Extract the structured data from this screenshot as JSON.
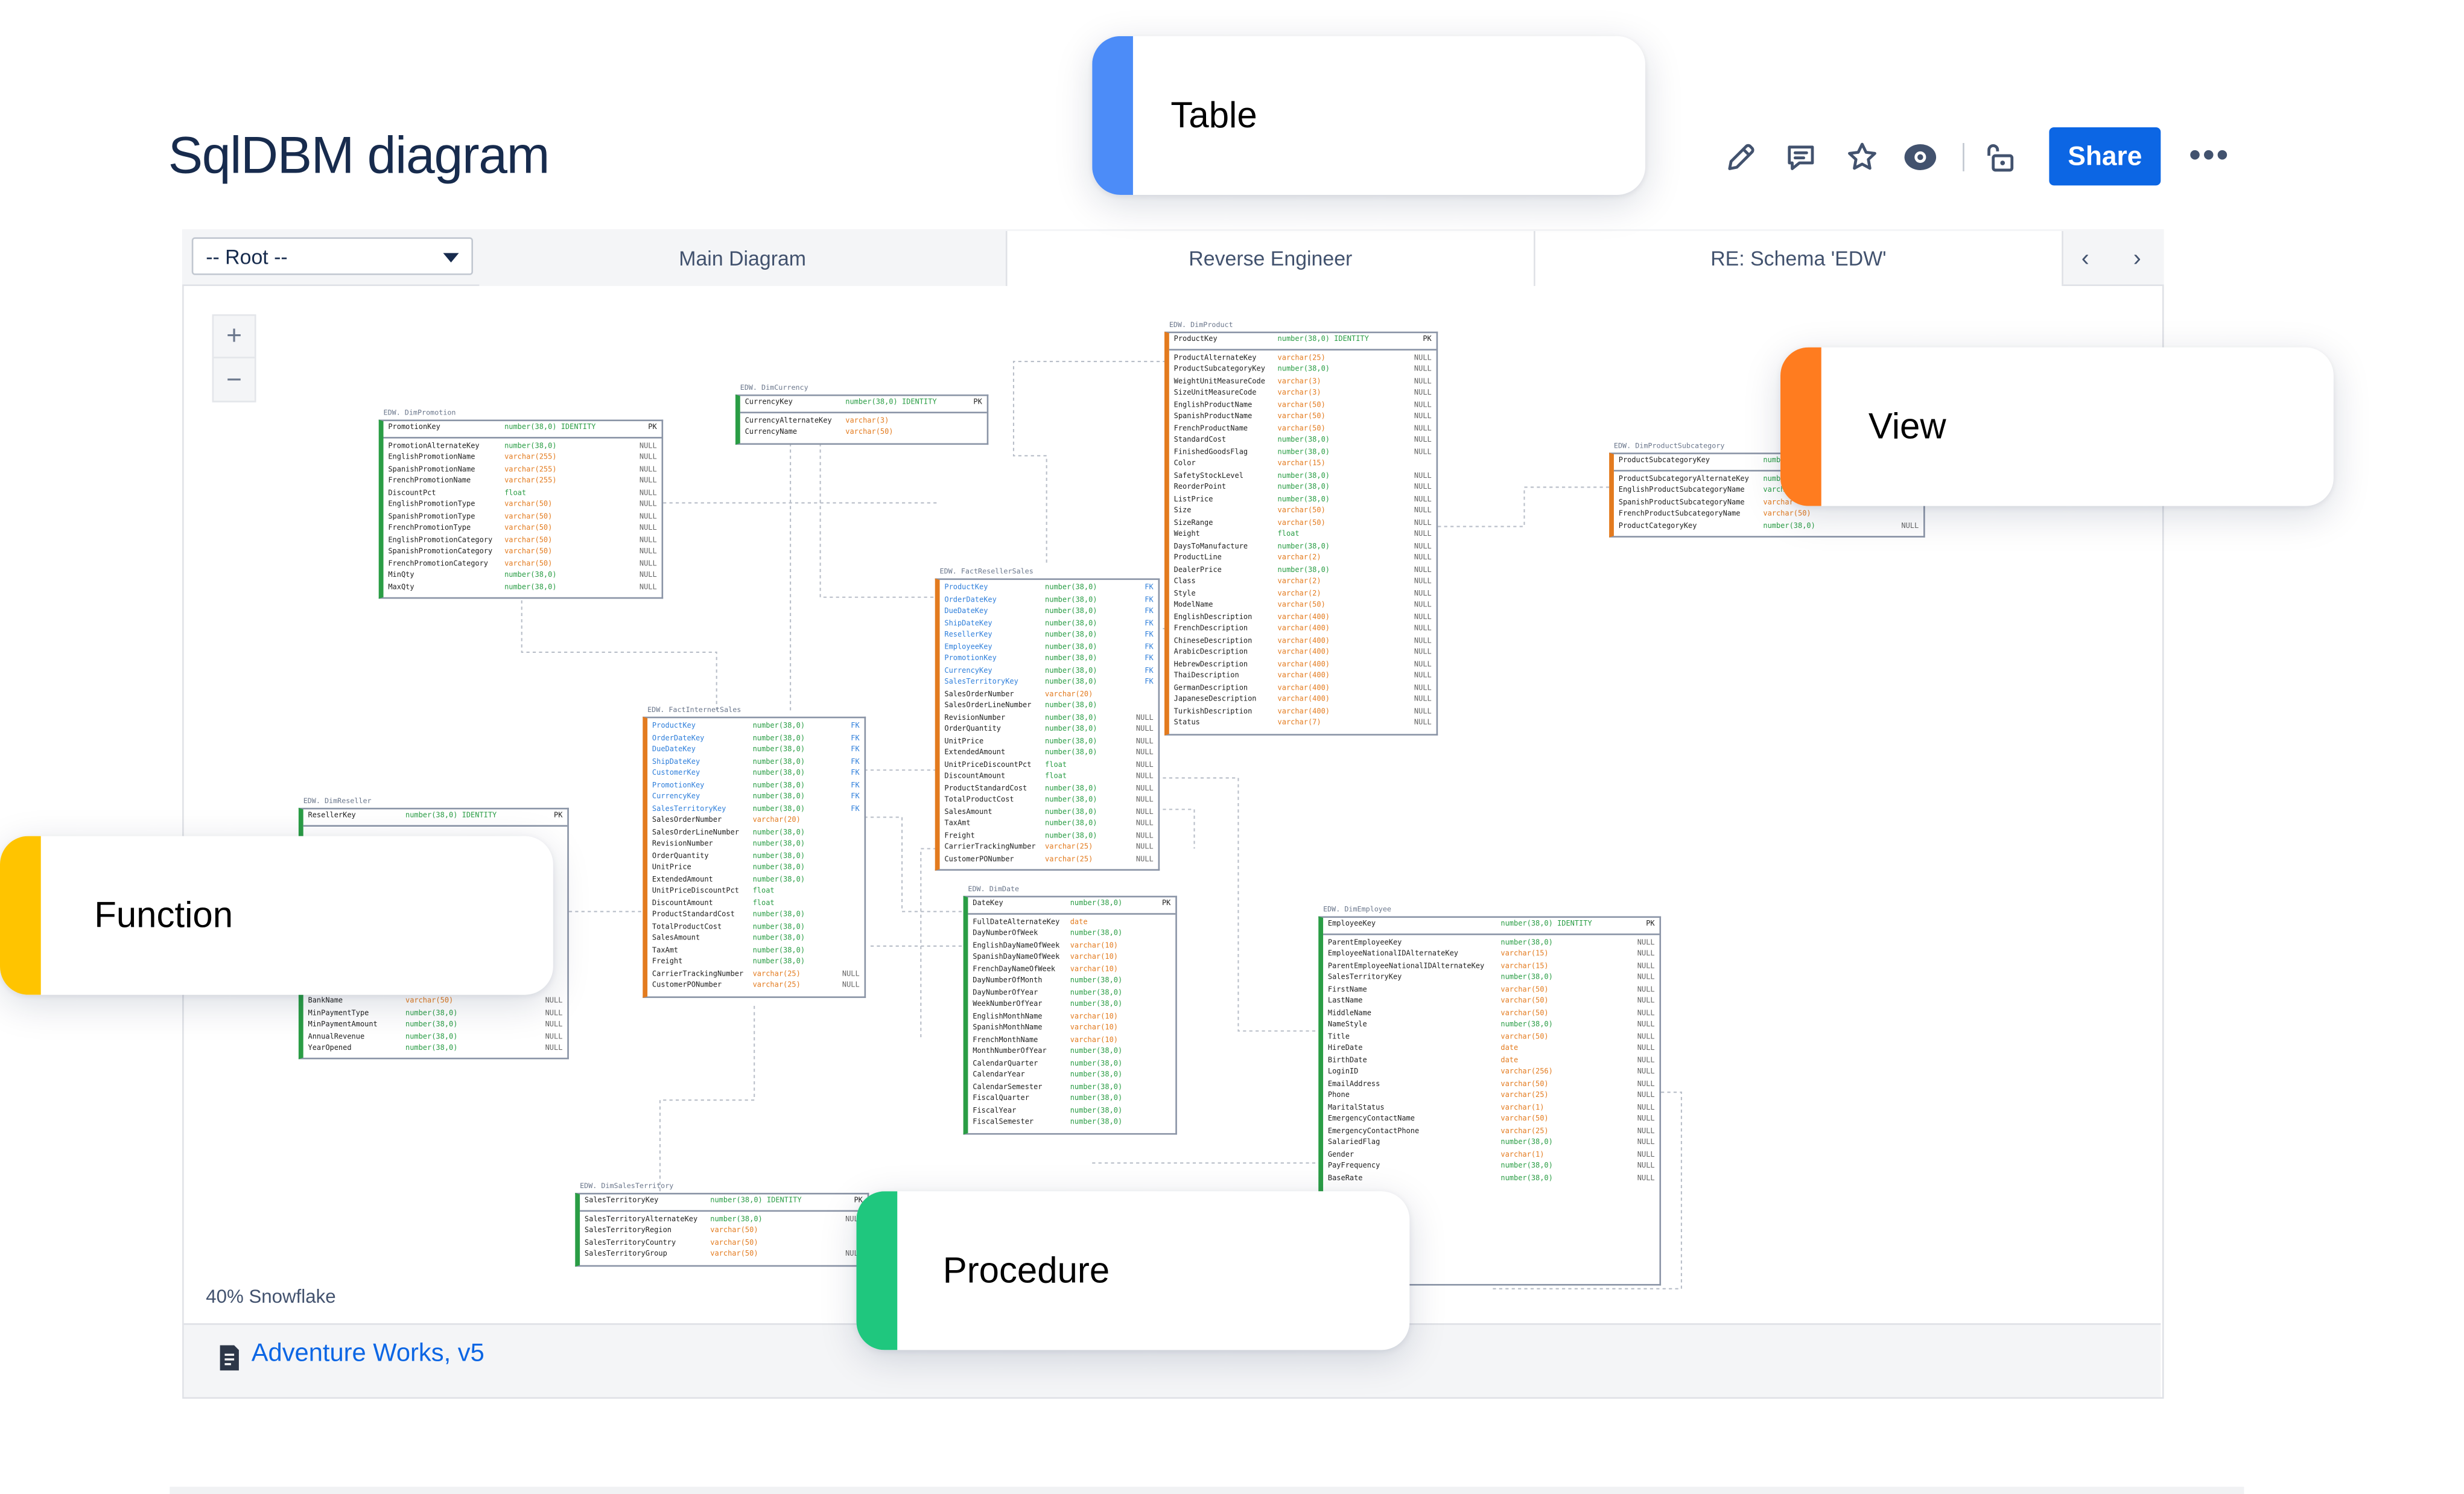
{
  "page": {
    "title": "SqlDBM diagram"
  },
  "toolbar": {
    "share_label": "Share",
    "more_label": "•••",
    "icons": [
      "pencil-icon",
      "comment-icon",
      "star-icon",
      "eye-icon",
      "unlock-icon"
    ]
  },
  "macro": {
    "root_select": "-- Root --",
    "tabs": [
      "Main Diagram",
      "Reverse Engineer",
      "RE: Schema 'EDW'"
    ],
    "prev": "‹",
    "next": "›",
    "zoom_in": "+",
    "zoom_out": "−",
    "zoom_label": "40% Snowflake",
    "footer_link": "Adventure Works, v5"
  },
  "callouts": {
    "table": "Table",
    "view": "View",
    "function": "Function",
    "procedure": "Procedure"
  },
  "colors": {
    "table": "#4c8cf8",
    "view": "#ff7c1f",
    "function": "#ffc400",
    "procedure": "#1fc77e",
    "share": "#0c66e4"
  },
  "diagram": {
    "dim_promotion": {
      "caption": "EDW. DimPromotion",
      "header": [
        "PromotionKey",
        "number(38,0) IDENTITY",
        "PK"
      ],
      "rows": [
        [
          "PromotionAlternateKey",
          "number(38,0)",
          "NULL"
        ],
        [
          "EnglishPromotionName",
          "varchar(255)",
          "NULL"
        ],
        [
          "SpanishPromotionName",
          "varchar(255)",
          "NULL"
        ],
        [
          "FrenchPromotionName",
          "varchar(255)",
          "NULL"
        ],
        [
          "DiscountPct",
          "float",
          "NULL"
        ],
        [
          "EnglishPromotionType",
          "varchar(50)",
          "NULL"
        ],
        [
          "SpanishPromotionType",
          "varchar(50)",
          "NULL"
        ],
        [
          "FrenchPromotionType",
          "varchar(50)",
          "NULL"
        ],
        [
          "EnglishPromotionCategory",
          "varchar(50)",
          "NULL"
        ],
        [
          "SpanishPromotionCategory",
          "varchar(50)",
          "NULL"
        ],
        [
          "FrenchPromotionCategory",
          "varchar(50)",
          "NULL"
        ],
        [
          "MinQty",
          "number(38,0)",
          "NULL"
        ],
        [
          "MaxQty",
          "number(38,0)",
          "NULL"
        ]
      ]
    },
    "dim_currency": {
      "caption": "EDW. DimCurrency",
      "header": [
        "CurrencyKey",
        "number(38,0) IDENTITY",
        "PK"
      ],
      "rows": [
        [
          "CurrencyAlternateKey",
          "varchar(3)",
          ""
        ],
        [
          "CurrencyName",
          "varchar(50)",
          ""
        ]
      ]
    },
    "dim_product": {
      "caption": "EDW. DimProduct",
      "header": [
        "ProductKey",
        "number(38,0) IDENTITY",
        "PK"
      ],
      "rows": [
        [
          "ProductAlternateKey",
          "varchar(25)",
          "NULL"
        ],
        [
          "ProductSubcategoryKey",
          "number(38,0)",
          "NULL"
        ],
        [
          "WeightUnitMeasureCode",
          "varchar(3)",
          "NULL"
        ],
        [
          "SizeUnitMeasureCode",
          "varchar(3)",
          "NULL"
        ],
        [
          "EnglishProductName",
          "varchar(50)",
          "NULL"
        ],
        [
          "SpanishProductName",
          "varchar(50)",
          "NULL"
        ],
        [
          "FrenchProductName",
          "varchar(50)",
          "NULL"
        ],
        [
          "StandardCost",
          "number(38,0)",
          "NULL"
        ],
        [
          "FinishedGoodsFlag",
          "number(38,0)",
          "NULL"
        ],
        [
          "Color",
          "varchar(15)",
          ""
        ],
        [
          "SafetyStockLevel",
          "number(38,0)",
          "NULL"
        ],
        [
          "ReorderPoint",
          "number(38,0)",
          "NULL"
        ],
        [
          "ListPrice",
          "number(38,0)",
          "NULL"
        ],
        [
          "Size",
          "varchar(50)",
          "NULL"
        ],
        [
          "SizeRange",
          "varchar(50)",
          "NULL"
        ],
        [
          "Weight",
          "float",
          "NULL"
        ],
        [
          "DaysToManufacture",
          "number(38,0)",
          "NULL"
        ],
        [
          "ProductLine",
          "varchar(2)",
          "NULL"
        ],
        [
          "DealerPrice",
          "number(38,0)",
          "NULL"
        ],
        [
          "Class",
          "varchar(2)",
          "NULL"
        ],
        [
          "Style",
          "varchar(2)",
          "NULL"
        ],
        [
          "ModelName",
          "varchar(50)",
          "NULL"
        ],
        [
          "EnglishDescription",
          "varchar(400)",
          "NULL"
        ],
        [
          "FrenchDescription",
          "varchar(400)",
          "NULL"
        ],
        [
          "ChineseDescription",
          "varchar(400)",
          "NULL"
        ],
        [
          "ArabicDescription",
          "varchar(400)",
          "NULL"
        ],
        [
          "HebrewDescription",
          "varchar(400)",
          "NULL"
        ],
        [
          "ThaiDescription",
          "varchar(400)",
          "NULL"
        ],
        [
          "GermanDescription",
          "varchar(400)",
          "NULL"
        ],
        [
          "JapaneseDescription",
          "varchar(400)",
          "NULL"
        ],
        [
          "TurkishDescription",
          "varchar(400)",
          "NULL"
        ],
        [
          "Status",
          "varchar(7)",
          "NULL"
        ]
      ]
    },
    "dim_product_subcategory": {
      "caption": "EDW. DimProductSubcategory",
      "header": [
        "ProductSubcategoryKey",
        "numb",
        ""
      ],
      "rows": [
        [
          "ProductSubcategoryAlternateKey",
          "numbe",
          ""
        ],
        [
          "EnglishProductSubcategoryName",
          "varcha",
          ""
        ],
        [
          "SpanishProductSubcategoryName",
          "varchar",
          ""
        ],
        [
          "FrenchProductSubcategoryName",
          "varchar(50)",
          ""
        ],
        [
          "ProductCategoryKey",
          "number(38,0)",
          "NULL"
        ]
      ]
    },
    "fact_reseller_sales": {
      "caption": "EDW. FactResellerSales",
      "rows": [
        [
          "ProductKey",
          "number(38,0)",
          "FK"
        ],
        [
          "OrderDateKey",
          "number(38,0)",
          "FK"
        ],
        [
          "DueDateKey",
          "number(38,0)",
          "FK"
        ],
        [
          "ShipDateKey",
          "number(38,0)",
          "FK"
        ],
        [
          "ResellerKey",
          "number(38,0)",
          "FK"
        ],
        [
          "EmployeeKey",
          "number(38,0)",
          "FK"
        ],
        [
          "PromotionKey",
          "number(38,0)",
          "FK"
        ],
        [
          "CurrencyKey",
          "number(38,0)",
          "FK"
        ],
        [
          "SalesTerritoryKey",
          "number(38,0)",
          "FK"
        ],
        [
          "SalesOrderNumber",
          "varchar(20)",
          ""
        ],
        [
          "SalesOrderLineNumber",
          "number(38,0)",
          ""
        ],
        [
          "RevisionNumber",
          "number(38,0)",
          "NULL"
        ],
        [
          "OrderQuantity",
          "number(38,0)",
          "NULL"
        ],
        [
          "UnitPrice",
          "number(38,0)",
          "NULL"
        ],
        [
          "ExtendedAmount",
          "number(38,0)",
          "NULL"
        ],
        [
          "UnitPriceDiscountPct",
          "float",
          "NULL"
        ],
        [
          "DiscountAmount",
          "float",
          "NULL"
        ],
        [
          "ProductStandardCost",
          "number(38,0)",
          "NULL"
        ],
        [
          "TotalProductCost",
          "number(38,0)",
          "NULL"
        ],
        [
          "SalesAmount",
          "number(38,0)",
          "NULL"
        ],
        [
          "TaxAmt",
          "number(38,0)",
          "NULL"
        ],
        [
          "Freight",
          "number(38,0)",
          "NULL"
        ],
        [
          "CarrierTrackingNumber",
          "varchar(25)",
          "NULL"
        ],
        [
          "CustomerPONumber",
          "varchar(25)",
          "NULL"
        ]
      ]
    },
    "fact_internet_sales": {
      "caption": "EDW. FactInternetSales",
      "rows": [
        [
          "ProductKey",
          "number(38,0)",
          "FK"
        ],
        [
          "OrderDateKey",
          "number(38,0)",
          "FK"
        ],
        [
          "DueDateKey",
          "number(38,0)",
          "FK"
        ],
        [
          "ShipDateKey",
          "number(38,0)",
          "FK"
        ],
        [
          "CustomerKey",
          "number(38,0)",
          "FK"
        ],
        [
          "PromotionKey",
          "number(38,0)",
          "FK"
        ],
        [
          "CurrencyKey",
          "number(38,0)",
          "FK"
        ],
        [
          "SalesTerritoryKey",
          "number(38,0)",
          "FK"
        ],
        [
          "SalesOrderNumber",
          "varchar(20)",
          ""
        ],
        [
          "SalesOrderLineNumber",
          "number(38,0)",
          ""
        ],
        [
          "RevisionNumber",
          "number(38,0)",
          ""
        ],
        [
          "OrderQuantity",
          "number(38,0)",
          ""
        ],
        [
          "UnitPrice",
          "number(38,0)",
          ""
        ],
        [
          "ExtendedAmount",
          "number(38,0)",
          ""
        ],
        [
          "UnitPriceDiscountPct",
          "float",
          ""
        ],
        [
          "DiscountAmount",
          "float",
          ""
        ],
        [
          "ProductStandardCost",
          "number(38,0)",
          ""
        ],
        [
          "TotalProductCost",
          "number(38,0)",
          ""
        ],
        [
          "SalesAmount",
          "number(38,0)",
          ""
        ],
        [
          "TaxAmt",
          "number(38,0)",
          ""
        ],
        [
          "Freight",
          "number(38,0)",
          ""
        ],
        [
          "CarrierTrackingNumber",
          "varchar(25)",
          "NULL"
        ],
        [
          "CustomerPONumber",
          "varchar(25)",
          "NULL"
        ]
      ]
    },
    "dim_reseller": {
      "caption": "EDW. DimReseller",
      "header": [
        "ResellerKey",
        "number(38,0) IDENTITY",
        "PK"
      ],
      "rows": [
        [
          "BankName",
          "varchar(50)",
          "NULL"
        ],
        [
          "MinPaymentType",
          "number(38,0)",
          "NULL"
        ],
        [
          "MinPaymentAmount",
          "number(38,0)",
          "NULL"
        ],
        [
          "AnnualRevenue",
          "number(38,0)",
          "NULL"
        ],
        [
          "YearOpened",
          "number(38,0)",
          "NULL"
        ]
      ]
    },
    "dim_date": {
      "caption": "EDW. DimDate",
      "header": [
        "DateKey",
        "number(38,0)",
        "PK"
      ],
      "rows": [
        [
          "FullDateAlternateKey",
          "date",
          ""
        ],
        [
          "DayNumberOfWeek",
          "number(38,0)",
          ""
        ],
        [
          "EnglishDayNameOfWeek",
          "varchar(10)",
          ""
        ],
        [
          "SpanishDayNameOfWeek",
          "varchar(10)",
          ""
        ],
        [
          "FrenchDayNameOfWeek",
          "varchar(10)",
          ""
        ],
        [
          "DayNumberOfMonth",
          "number(38,0)",
          ""
        ],
        [
          "DayNumberOfYear",
          "number(38,0)",
          ""
        ],
        [
          "WeekNumberOfYear",
          "number(38,0)",
          ""
        ],
        [
          "EnglishMonthName",
          "varchar(10)",
          ""
        ],
        [
          "SpanishMonthName",
          "varchar(10)",
          ""
        ],
        [
          "FrenchMonthName",
          "varchar(10)",
          ""
        ],
        [
          "MonthNumberOfYear",
          "number(38,0)",
          ""
        ],
        [
          "CalendarQuarter",
          "number(38,0)",
          ""
        ],
        [
          "CalendarYear",
          "number(38,0)",
          ""
        ],
        [
          "CalendarSemester",
          "number(38,0)",
          ""
        ],
        [
          "FiscalQuarter",
          "number(38,0)",
          ""
        ],
        [
          "FiscalYear",
          "number(38,0)",
          ""
        ],
        [
          "FiscalSemester",
          "number(38,0)",
          ""
        ]
      ]
    },
    "dim_employee": {
      "caption": "EDW. DimEmployee",
      "header": [
        "EmployeeKey",
        "number(38,0) IDENTITY",
        "PK"
      ],
      "rows": [
        [
          "ParentEmployeeKey",
          "number(38,0)",
          "NULL"
        ],
        [
          "EmployeeNationalIDAlternateKey",
          "varchar(15)",
          "NULL"
        ],
        [
          "ParentEmployeeNationalIDAlternateKey",
          "varchar(15)",
          "NULL"
        ],
        [
          "SalesTerritoryKey",
          "number(38,0)",
          "NULL"
        ],
        [
          "FirstName",
          "varchar(50)",
          "NULL"
        ],
        [
          "LastName",
          "varchar(50)",
          "NULL"
        ],
        [
          "MiddleName",
          "varchar(50)",
          "NULL"
        ],
        [
          "NameStyle",
          "number(38,0)",
          "NULL"
        ],
        [
          "Title",
          "varchar(50)",
          "NULL"
        ],
        [
          "HireDate",
          "date",
          "NULL"
        ],
        [
          "BirthDate",
          "date",
          "NULL"
        ],
        [
          "LoginID",
          "varchar(256)",
          "NULL"
        ],
        [
          "EmailAddress",
          "varchar(50)",
          "NULL"
        ],
        [
          "Phone",
          "varchar(25)",
          "NULL"
        ],
        [
          "MaritalStatus",
          "varchar(1)",
          "NULL"
        ],
        [
          "EmergencyContactName",
          "varchar(50)",
          "NULL"
        ],
        [
          "EmergencyContactPhone",
          "varchar(25)",
          "NULL"
        ],
        [
          "SalariedFlag",
          "number(38,0)",
          "NULL"
        ],
        [
          "Gender",
          "varchar(1)",
          "NULL"
        ],
        [
          "PayFrequency",
          "number(38,0)",
          "NULL"
        ],
        [
          "BaseRate",
          "number(38,0)",
          "NULL"
        ]
      ]
    },
    "dim_sales_territory": {
      "caption": "EDW. DimSalesTerritory",
      "header": [
        "SalesTerritoryKey",
        "number(38,0) IDENTITY",
        "PK"
      ],
      "rows": [
        [
          "SalesTerritoryAlternateKey",
          "number(38,0)",
          "NULL"
        ],
        [
          "SalesTerritoryRegion",
          "varchar(50)",
          ""
        ],
        [
          "SalesTerritoryCountry",
          "varchar(50)",
          ""
        ],
        [
          "SalesTerritoryGroup",
          "varchar(50)",
          "NULL"
        ]
      ]
    }
  }
}
